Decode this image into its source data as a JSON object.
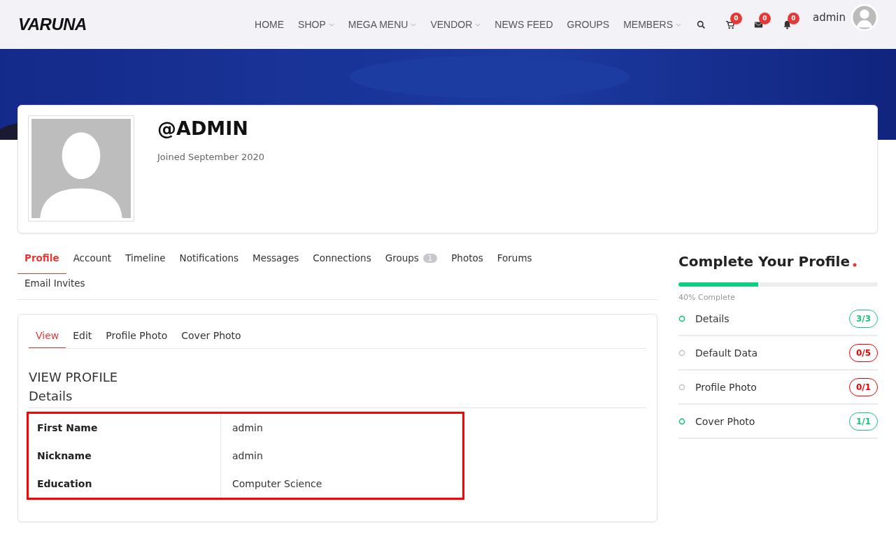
{
  "header": {
    "logo": "VARUNA",
    "nav": [
      {
        "label": "HOME",
        "dropdown": false
      },
      {
        "label": "SHOP",
        "dropdown": true
      },
      {
        "label": "MEGA MENU",
        "dropdown": true
      },
      {
        "label": "VENDOR",
        "dropdown": true
      },
      {
        "label": "NEWS FEED",
        "dropdown": false
      },
      {
        "label": "GROUPS",
        "dropdown": false
      },
      {
        "label": "MEMBERS",
        "dropdown": true
      }
    ],
    "icons": [
      {
        "kind": "search"
      },
      {
        "kind": "cart",
        "count": "0"
      },
      {
        "kind": "mail",
        "count": "0"
      },
      {
        "kind": "bell",
        "count": "0"
      }
    ],
    "user": "admin"
  },
  "profile": {
    "handle": "@ADMIN",
    "joined": "Joined September 2020"
  },
  "tabs": [
    {
      "label": "Profile",
      "selected": true
    },
    {
      "label": "Account",
      "selected": false
    },
    {
      "label": "Timeline",
      "selected": false
    },
    {
      "label": "Notifications",
      "selected": false
    },
    {
      "label": "Messages",
      "selected": false
    },
    {
      "label": "Connections",
      "selected": false
    },
    {
      "label": "Groups",
      "selected": false,
      "count": "1"
    },
    {
      "label": "Photos",
      "selected": false
    },
    {
      "label": "Forums",
      "selected": false
    },
    {
      "label": "Email Invites",
      "selected": false
    }
  ],
  "subtabs": [
    {
      "label": "View",
      "selected": true
    },
    {
      "label": "Edit",
      "selected": false
    },
    {
      "label": "Profile Photo",
      "selected": false
    },
    {
      "label": "Cover Photo",
      "selected": false
    }
  ],
  "section_title": "VIEW PROFILE",
  "group_title": "Details",
  "details": {
    "highlighted": true,
    "rows": [
      {
        "field": "First Name",
        "value": "admin"
      },
      {
        "field": "Nickname",
        "value": "admin"
      },
      {
        "field": "Education",
        "value": "Computer Science"
      }
    ]
  },
  "completion": {
    "title": "Complete Your Profile",
    "level": 0.4,
    "caption": "40% Complete",
    "items": [
      {
        "label": "Details",
        "count": "3/3",
        "complete": true
      },
      {
        "label": "Default Data",
        "count": "0/5",
        "complete": false
      },
      {
        "label": "Profile Photo",
        "count": "0/1",
        "complete": false
      },
      {
        "label": "Cover Photo",
        "count": "1/1",
        "complete": true
      }
    ]
  }
}
